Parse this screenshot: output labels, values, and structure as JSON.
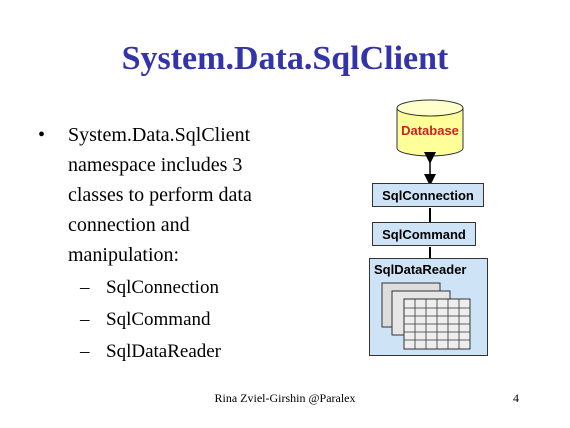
{
  "slide": {
    "title": "System.Data.SqlClient",
    "bullet": {
      "lines": [
        "System.Data.SqlClient",
        "namespace includes 3",
        "classes to perform data",
        "connection and",
        "manipulation:"
      ],
      "subitems": [
        "SqlConnection",
        "SqlCommand",
        "SqlDataReader"
      ]
    },
    "diagram": {
      "database_label": "Database",
      "connection_label": "SqlConnection",
      "command_label": "SqlCommand",
      "reader_label": "SqlDataReader",
      "database_color": "#ffff99",
      "database_text_color": "#cc2222",
      "box_color": "#cfe3f7"
    },
    "footer": {
      "author": "Rina Zviel-Girshin   @Paralex",
      "page_number": "4"
    },
    "title_color": "#3333aa"
  }
}
